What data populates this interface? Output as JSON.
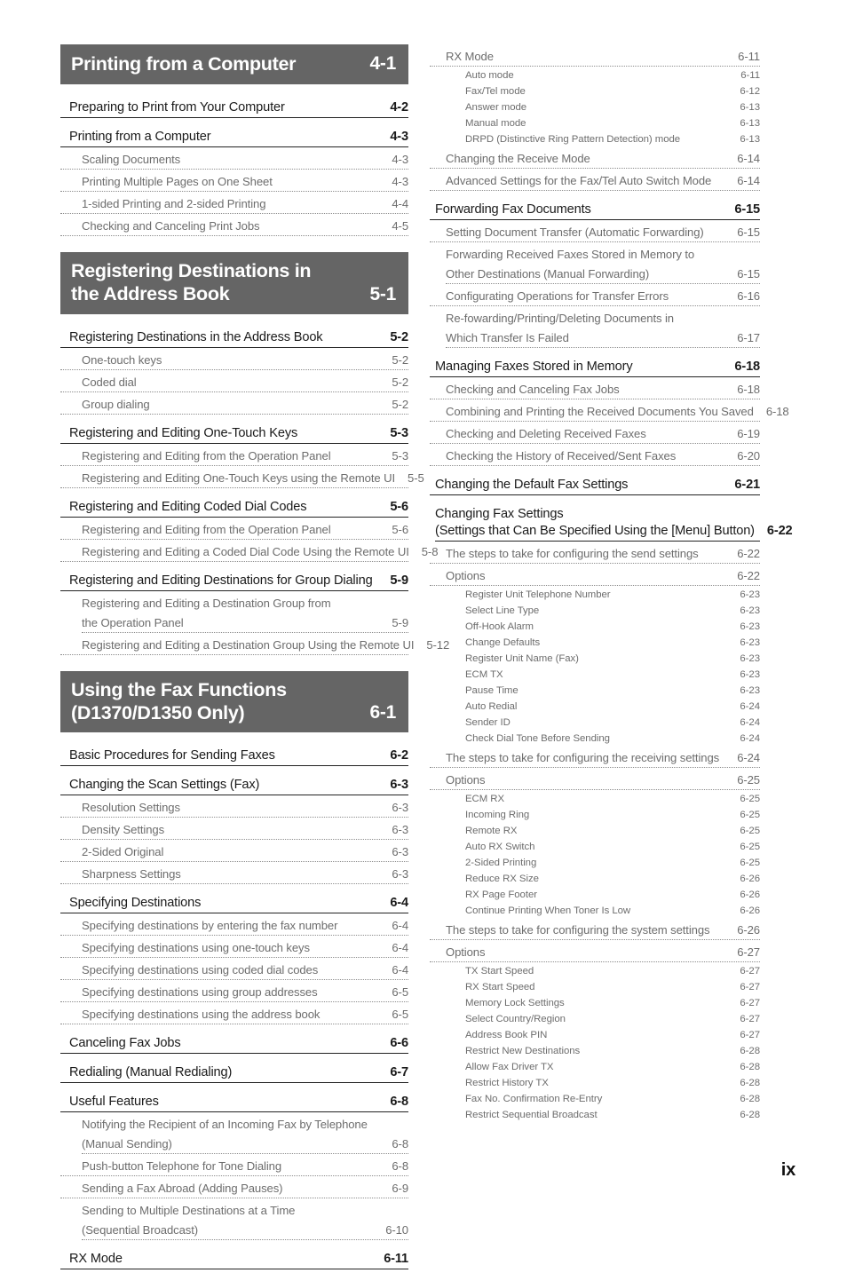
{
  "folio": "ix",
  "left_column": [
    {
      "kind": "chapter",
      "title": "Printing from a Computer",
      "page": "4-1",
      "two_line": false
    },
    {
      "kind": "l2",
      "label": "Preparing to Print from Your Computer",
      "page": "4-2"
    },
    {
      "kind": "l2",
      "label": "Printing from a Computer",
      "page": "4-3"
    },
    {
      "kind": "l3",
      "label": "Scaling Documents",
      "page": "4-3"
    },
    {
      "kind": "l3",
      "label": "Printing Multiple Pages on One Sheet",
      "page": "4-3"
    },
    {
      "kind": "l3",
      "label": "1-sided Printing and 2-sided Printing",
      "page": "4-4"
    },
    {
      "kind": "l3",
      "label": "Checking and Canceling Print Jobs",
      "page": "4-5"
    },
    {
      "kind": "chapter",
      "title": "Registering Destinations in\n    the Address Book",
      "page": "5-1",
      "two_line": true
    },
    {
      "kind": "l2",
      "label": "Registering Destinations in the Address Book",
      "page": "5-2"
    },
    {
      "kind": "l3",
      "label": "One-touch keys",
      "page": "5-2"
    },
    {
      "kind": "l3",
      "label": "Coded dial",
      "page": "5-2"
    },
    {
      "kind": "l3",
      "label": "Group dialing",
      "page": "5-2"
    },
    {
      "kind": "l2",
      "label": "Registering and Editing One-Touch Keys",
      "page": "5-3"
    },
    {
      "kind": "l3",
      "label": "Registering and Editing from the Operation Panel",
      "page": "5-3"
    },
    {
      "kind": "l3",
      "label": "Registering and Editing One-Touch Keys using the Remote UI",
      "page": "5-5"
    },
    {
      "kind": "l2",
      "label": "Registering and Editing Coded Dial Codes",
      "page": "5-6"
    },
    {
      "kind": "l3",
      "label": "Registering and Editing from the Operation Panel",
      "page": "5-6"
    },
    {
      "kind": "l3",
      "label": "Registering and Editing a Coded Dial Code Using the Remote UI",
      "page": "5-8"
    },
    {
      "kind": "l2",
      "label": "Registering and Editing Destinations for Group Dialing",
      "page": "5-9"
    },
    {
      "kind": "l3wrap",
      "line1": "Registering and Editing a Destination Group from",
      "line2": "the Operation Panel",
      "page": "5-9"
    },
    {
      "kind": "l3",
      "label": "Registering and Editing a Destination Group Using the Remote UI",
      "page": "5-12"
    },
    {
      "kind": "chapter",
      "title": "Using the Fax Functions\n    (D1370/D1350 Only)",
      "page": "6-1",
      "two_line": true
    },
    {
      "kind": "l2",
      "label": "Basic Procedures for Sending Faxes",
      "page": "6-2"
    },
    {
      "kind": "l2",
      "label": "Changing the Scan Settings (Fax)",
      "page": "6-3"
    },
    {
      "kind": "l3",
      "label": "Resolution Settings",
      "page": "6-3"
    },
    {
      "kind": "l3",
      "label": "Density Settings",
      "page": "6-3"
    },
    {
      "kind": "l3",
      "label": "2-Sided Original",
      "page": "6-3"
    },
    {
      "kind": "l3",
      "label": "Sharpness Settings",
      "page": "6-3"
    },
    {
      "kind": "l2",
      "label": "Specifying Destinations",
      "page": "6-4"
    },
    {
      "kind": "l3",
      "label": "Specifying destinations by entering the fax number",
      "page": "6-4"
    },
    {
      "kind": "l3",
      "label": "Specifying destinations using one-touch keys",
      "page": "6-4"
    },
    {
      "kind": "l3",
      "label": "Specifying destinations using coded dial codes",
      "page": "6-4"
    },
    {
      "kind": "l3",
      "label": "Specifying destinations using group addresses",
      "page": "6-5"
    },
    {
      "kind": "l3",
      "label": "Specifying destinations using the address book",
      "page": "6-5"
    },
    {
      "kind": "l2",
      "label": "Canceling Fax Jobs",
      "page": "6-6"
    },
    {
      "kind": "l2",
      "label": "Redialing (Manual Redialing)",
      "page": "6-7"
    },
    {
      "kind": "l2",
      "label": "Useful Features",
      "page": "6-8"
    },
    {
      "kind": "l3wrap",
      "line1": "Notifying the Recipient of an Incoming Fax by Telephone",
      "line2": "(Manual Sending)",
      "page": "6-8"
    },
    {
      "kind": "l3",
      "label": "Push-button Telephone for Tone Dialing",
      "page": "6-8"
    },
    {
      "kind": "l3",
      "label": "Sending a Fax Abroad (Adding Pauses)",
      "page": "6-9"
    },
    {
      "kind": "l3wrap",
      "line1": "Sending to Multiple Destinations at a Time",
      "line2": "(Sequential Broadcast)",
      "page": "6-10"
    },
    {
      "kind": "l2",
      "label": "RX Mode",
      "page": "6-11"
    }
  ],
  "right_column": [
    {
      "kind": "l3",
      "label": "RX Mode",
      "page": "6-11"
    },
    {
      "kind": "l4",
      "label": "Auto mode",
      "page": "6-11"
    },
    {
      "kind": "l4",
      "label": "Fax/Tel mode",
      "page": "6-12"
    },
    {
      "kind": "l4",
      "label": "Answer mode",
      "page": "6-13"
    },
    {
      "kind": "l4",
      "label": "Manual mode",
      "page": "6-13"
    },
    {
      "kind": "l4",
      "label": "DRPD (Distinctive Ring Pattern Detection) mode",
      "page": "6-13"
    },
    {
      "kind": "l3",
      "label": "Changing the Receive Mode",
      "page": "6-14"
    },
    {
      "kind": "l3",
      "label": "Advanced Settings for the Fax/Tel Auto Switch Mode",
      "page": "6-14"
    },
    {
      "kind": "l2",
      "label": "Forwarding Fax Documents",
      "page": "6-15"
    },
    {
      "kind": "l3",
      "label": "Setting Document Transfer (Automatic Forwarding)",
      "page": "6-15"
    },
    {
      "kind": "l3wrap",
      "line1": "Forwarding Received Faxes Stored in Memory to",
      "line2": "Other Destinations (Manual Forwarding)",
      "page": "6-15"
    },
    {
      "kind": "l3",
      "label": "Configurating Operations for Transfer Errors",
      "page": "6-16"
    },
    {
      "kind": "l3wrap",
      "line1": "Re-fowarding/Printing/Deleting Documents in",
      "line2": "Which Transfer Is Failed",
      "page": "6-17"
    },
    {
      "kind": "l2",
      "label": "Managing Faxes Stored in Memory",
      "page": "6-18"
    },
    {
      "kind": "l3",
      "label": "Checking and Canceling Fax Jobs",
      "page": "6-18"
    },
    {
      "kind": "l3",
      "label": "Combining and Printing the Received Documents You Saved",
      "page": "6-18"
    },
    {
      "kind": "l3",
      "label": "Checking and Deleting Received Faxes",
      "page": "6-19"
    },
    {
      "kind": "l3",
      "label": "Checking the History of Received/Sent Faxes",
      "page": "6-20"
    },
    {
      "kind": "l2",
      "label": "Changing the Default Fax Settings",
      "page": "6-21"
    },
    {
      "kind": "l2wrap",
      "line1": "Changing Fax Settings",
      "line2": "(Settings that Can Be Specified Using the [Menu] Button)",
      "page": "6-22"
    },
    {
      "kind": "l3",
      "label": "The steps to take for configuring the send settings",
      "page": "6-22"
    },
    {
      "kind": "l3",
      "label": "Options",
      "page": "6-22"
    },
    {
      "kind": "l4",
      "label": "Register Unit Telephone Number",
      "page": "6-23"
    },
    {
      "kind": "l4",
      "label": "Select Line Type",
      "page": "6-23"
    },
    {
      "kind": "l4",
      "label": "Off-Hook Alarm",
      "page": "6-23"
    },
    {
      "kind": "l4",
      "label": "Change Defaults",
      "page": "6-23"
    },
    {
      "kind": "l4",
      "label": "Register Unit Name (Fax)",
      "page": "6-23"
    },
    {
      "kind": "l4",
      "label": "ECM TX",
      "page": "6-23"
    },
    {
      "kind": "l4",
      "label": "Pause Time",
      "page": "6-23"
    },
    {
      "kind": "l4",
      "label": "Auto Redial",
      "page": "6-24"
    },
    {
      "kind": "l4",
      "label": "Sender ID",
      "page": "6-24"
    },
    {
      "kind": "l4",
      "label": "Check Dial Tone Before Sending",
      "page": "6-24"
    },
    {
      "kind": "l3",
      "label": "The steps to take for configuring the receiving settings",
      "page": "6-24"
    },
    {
      "kind": "l3",
      "label": "Options",
      "page": "6-25"
    },
    {
      "kind": "l4",
      "label": "ECM RX",
      "page": "6-25"
    },
    {
      "kind": "l4",
      "label": "Incoming Ring",
      "page": "6-25"
    },
    {
      "kind": "l4",
      "label": "Remote RX",
      "page": "6-25"
    },
    {
      "kind": "l4",
      "label": "Auto RX Switch",
      "page": "6-25"
    },
    {
      "kind": "l4",
      "label": "2-Sided Printing",
      "page": "6-25"
    },
    {
      "kind": "l4",
      "label": "Reduce RX Size",
      "page": "6-26"
    },
    {
      "kind": "l4",
      "label": "RX Page Footer",
      "page": "6-26"
    },
    {
      "kind": "l4",
      "label": "Continue Printing When Toner Is Low",
      "page": "6-26"
    },
    {
      "kind": "l3",
      "label": "The steps to take for configuring the system settings",
      "page": "6-26"
    },
    {
      "kind": "l3",
      "label": "Options",
      "page": "6-27"
    },
    {
      "kind": "l4",
      "label": "TX Start Speed",
      "page": "6-27"
    },
    {
      "kind": "l4",
      "label": "RX Start Speed",
      "page": "6-27"
    },
    {
      "kind": "l4",
      "label": "Memory Lock Settings",
      "page": "6-27"
    },
    {
      "kind": "l4",
      "label": "Select Country/Region",
      "page": "6-27"
    },
    {
      "kind": "l4",
      "label": "Address Book PIN",
      "page": "6-27"
    },
    {
      "kind": "l4",
      "label": "Restrict New Destinations",
      "page": "6-28"
    },
    {
      "kind": "l4",
      "label": "Allow Fax Driver TX",
      "page": "6-28"
    },
    {
      "kind": "l4",
      "label": "Restrict History TX",
      "page": "6-28"
    },
    {
      "kind": "l4",
      "label": "Fax No. Confirmation Re-Entry",
      "page": "6-28"
    },
    {
      "kind": "l4",
      "label": "Restrict Sequential Broadcast",
      "page": "6-28"
    }
  ],
  "colors": {
    "chapter_bar": "#656565",
    "level2_text": "#1a1a1a",
    "level3_text": "#6d6d6d",
    "level4_text": "#6d6d6d"
  }
}
